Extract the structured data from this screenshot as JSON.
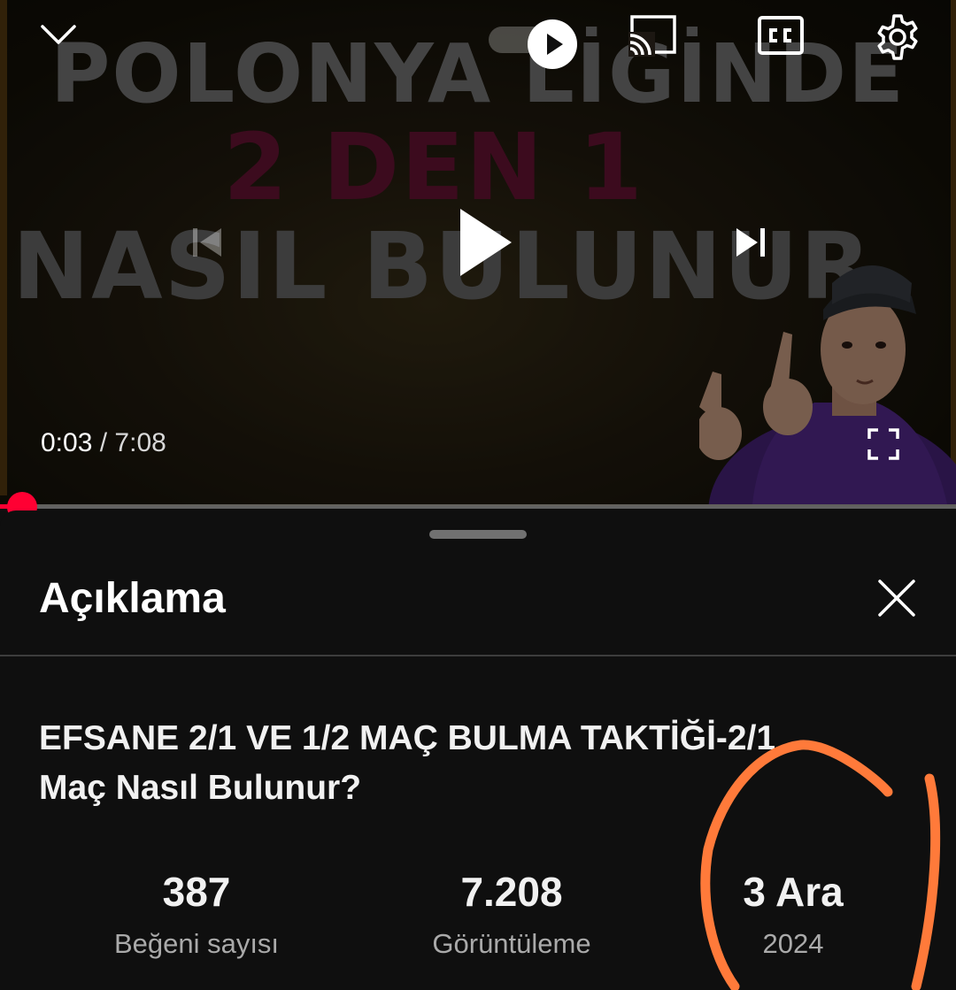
{
  "player": {
    "thumbnail_text": {
      "line1": "POLONYA LİGİNDE",
      "line2": "2 DEN 1",
      "line3": "NASIL BULUNUR"
    },
    "current_time": "0:03",
    "time_separator": "/",
    "duration": "7:08",
    "progress_fraction": 0.007,
    "accent_color": "#ff0033",
    "icons": [
      "chevron-down-icon",
      "autoplay-play-icon",
      "cast-icon",
      "cc-icon",
      "gear-icon",
      "previous-icon",
      "play-icon",
      "next-icon",
      "fullscreen-icon"
    ]
  },
  "description_panel": {
    "title": "Açıklama",
    "close_icon": "close-icon",
    "video_title": "EFSANE 2/1 VE 1/2 MAÇ BULMA TAKTİĞİ-2/1 Maç Nasıl Bulunur?",
    "stats": {
      "likes": {
        "value": "387",
        "label": "Beğeni sayısı"
      },
      "views": {
        "value": "7.208",
        "label": "Görüntüleme"
      },
      "date": {
        "value": "3 Ara",
        "label": "2024"
      }
    },
    "annotation_color": "#ff7a3a"
  }
}
